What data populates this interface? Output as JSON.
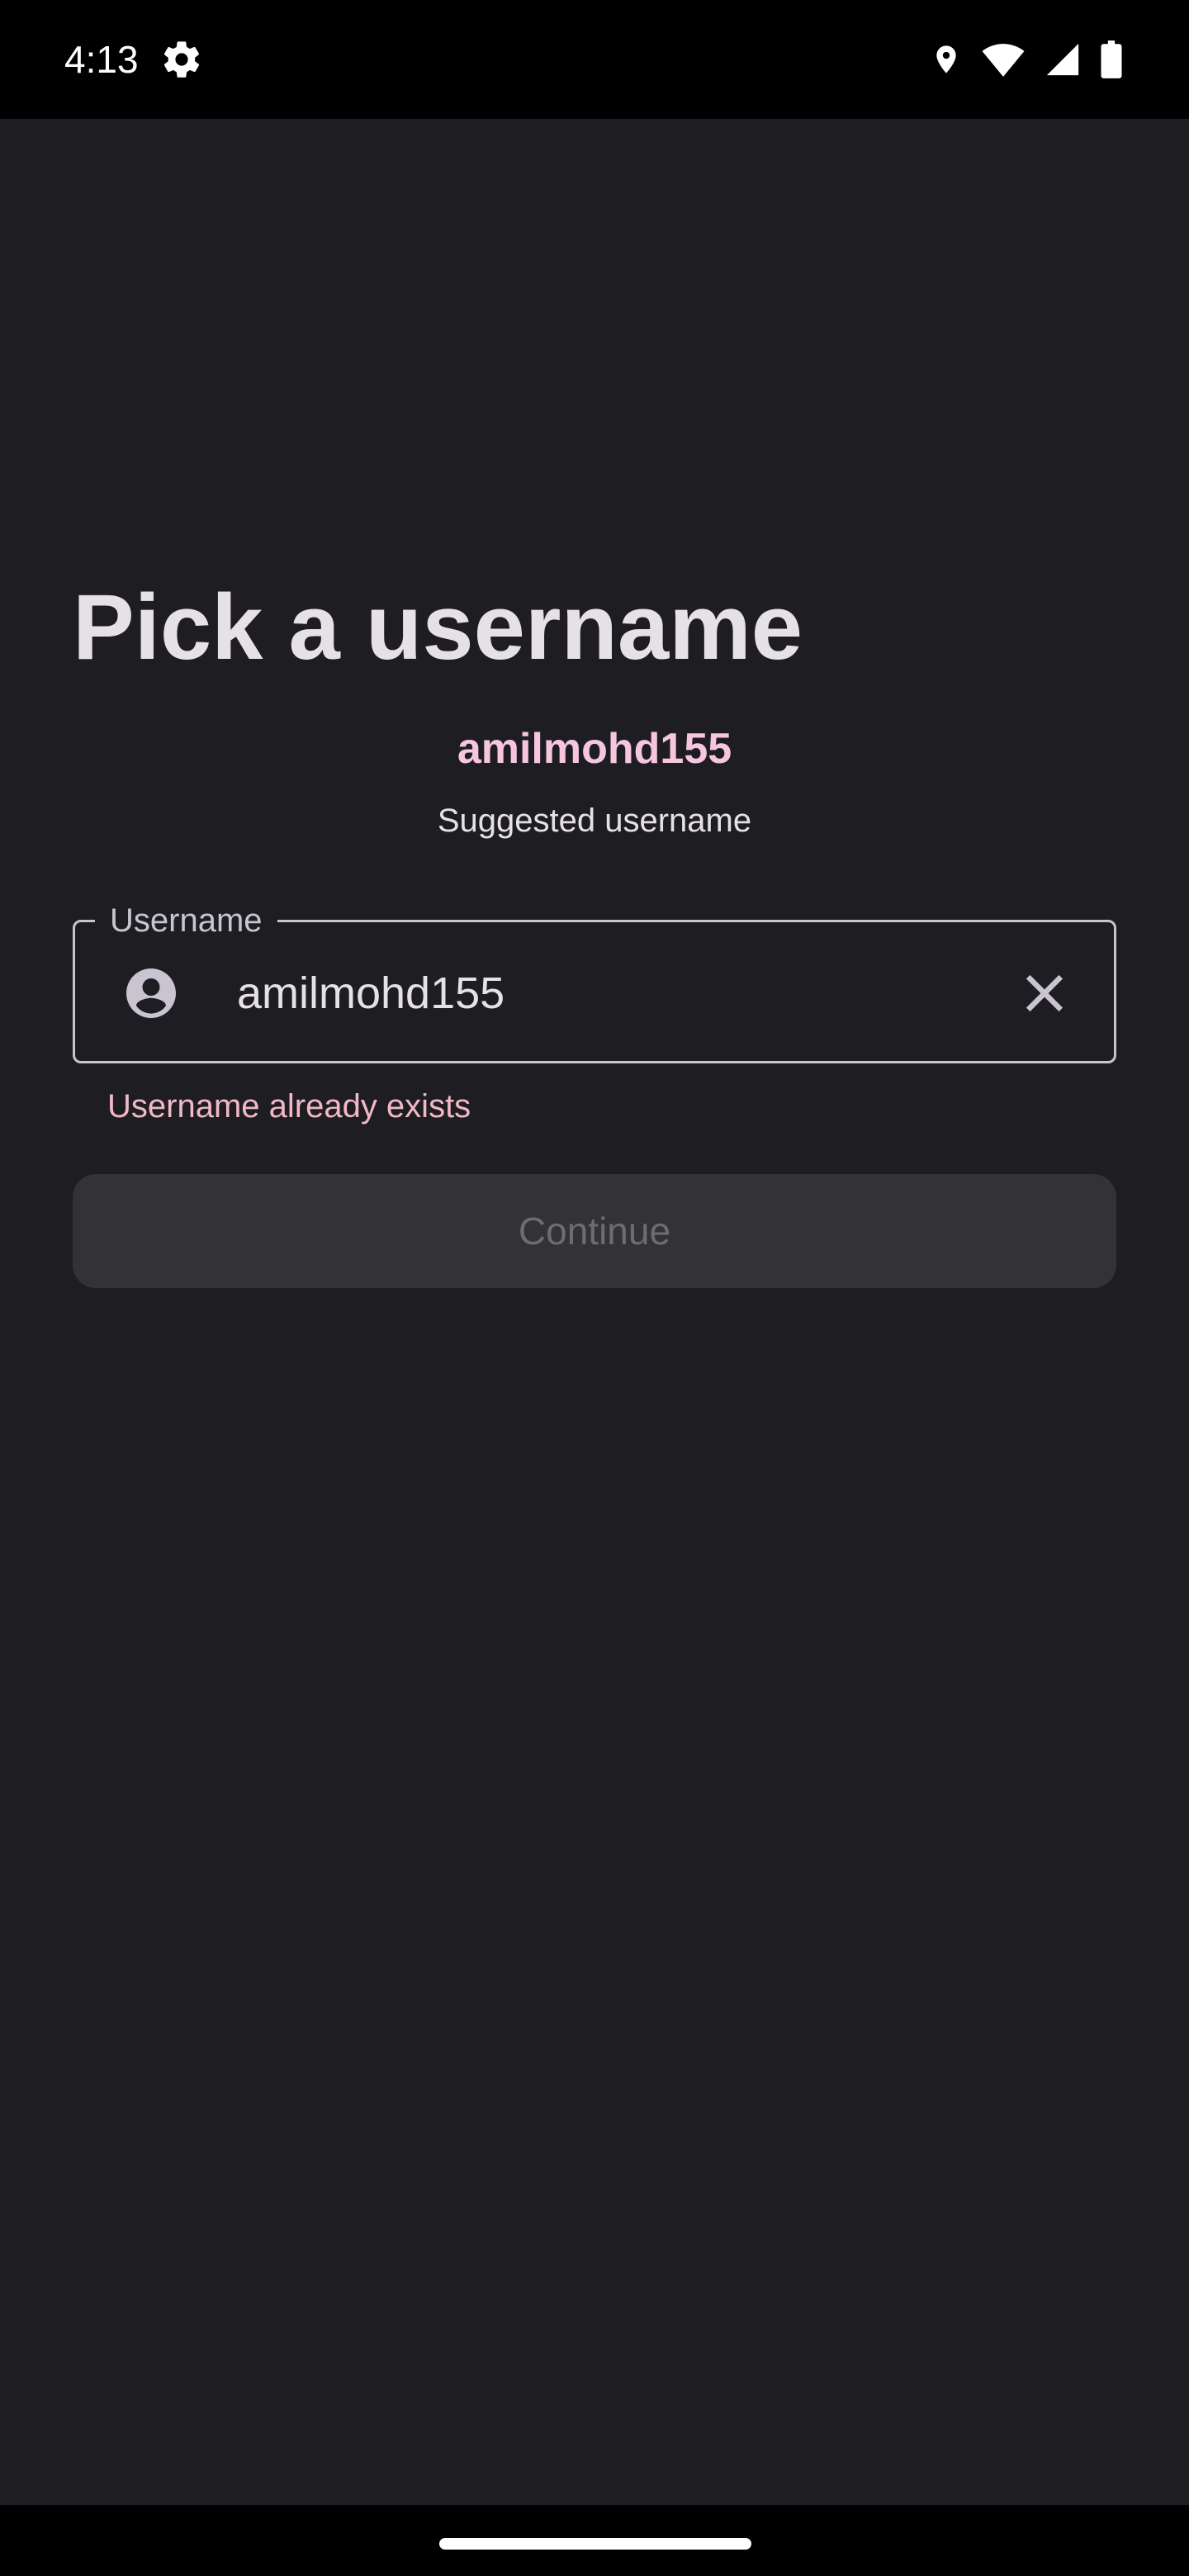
{
  "status_bar": {
    "time": "4:13",
    "icons": [
      "settings-gear-icon",
      "location-icon",
      "wifi-icon",
      "signal-icon",
      "battery-icon"
    ]
  },
  "page": {
    "title": "Pick a username",
    "suggested_username": "amilmohd155",
    "suggested_label": "Suggested username"
  },
  "username_field": {
    "label": "Username",
    "value": "amilmohd155",
    "leading_icon": "account-circle-icon",
    "trailing_icon": "close-icon",
    "error": "Username already exists"
  },
  "continue_button": {
    "label": "Continue",
    "enabled": false
  },
  "colors": {
    "background": "#1e1e22",
    "accent": "#f5c6dd",
    "error": "#f2b8c6",
    "disabled_button": "#333236"
  }
}
